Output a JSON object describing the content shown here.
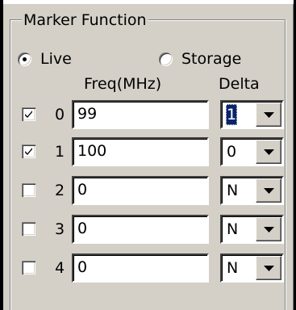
{
  "groupbox": {
    "title": "Marker Function"
  },
  "mode": {
    "options": [
      {
        "label": "Live",
        "selected": true
      },
      {
        "label": "Storage",
        "selected": false
      }
    ]
  },
  "columns": {
    "freq": "Freq(MHz)",
    "delta": "Delta"
  },
  "markers": [
    {
      "index": "0",
      "checked": true,
      "freq": "99",
      "delta": "1",
      "delta_focused": true
    },
    {
      "index": "1",
      "checked": true,
      "freq": "100",
      "delta": "0",
      "delta_focused": false
    },
    {
      "index": "2",
      "checked": false,
      "freq": "0",
      "delta": "N",
      "delta_focused": false
    },
    {
      "index": "3",
      "checked": false,
      "freq": "0",
      "delta": "N",
      "delta_focused": false
    },
    {
      "index": "4",
      "checked": false,
      "freq": "0",
      "delta": "N",
      "delta_focused": false
    }
  ],
  "icons": {
    "check": "check-icon",
    "dropdown": "chevron-down-icon",
    "radio": "radio-dot-icon"
  }
}
